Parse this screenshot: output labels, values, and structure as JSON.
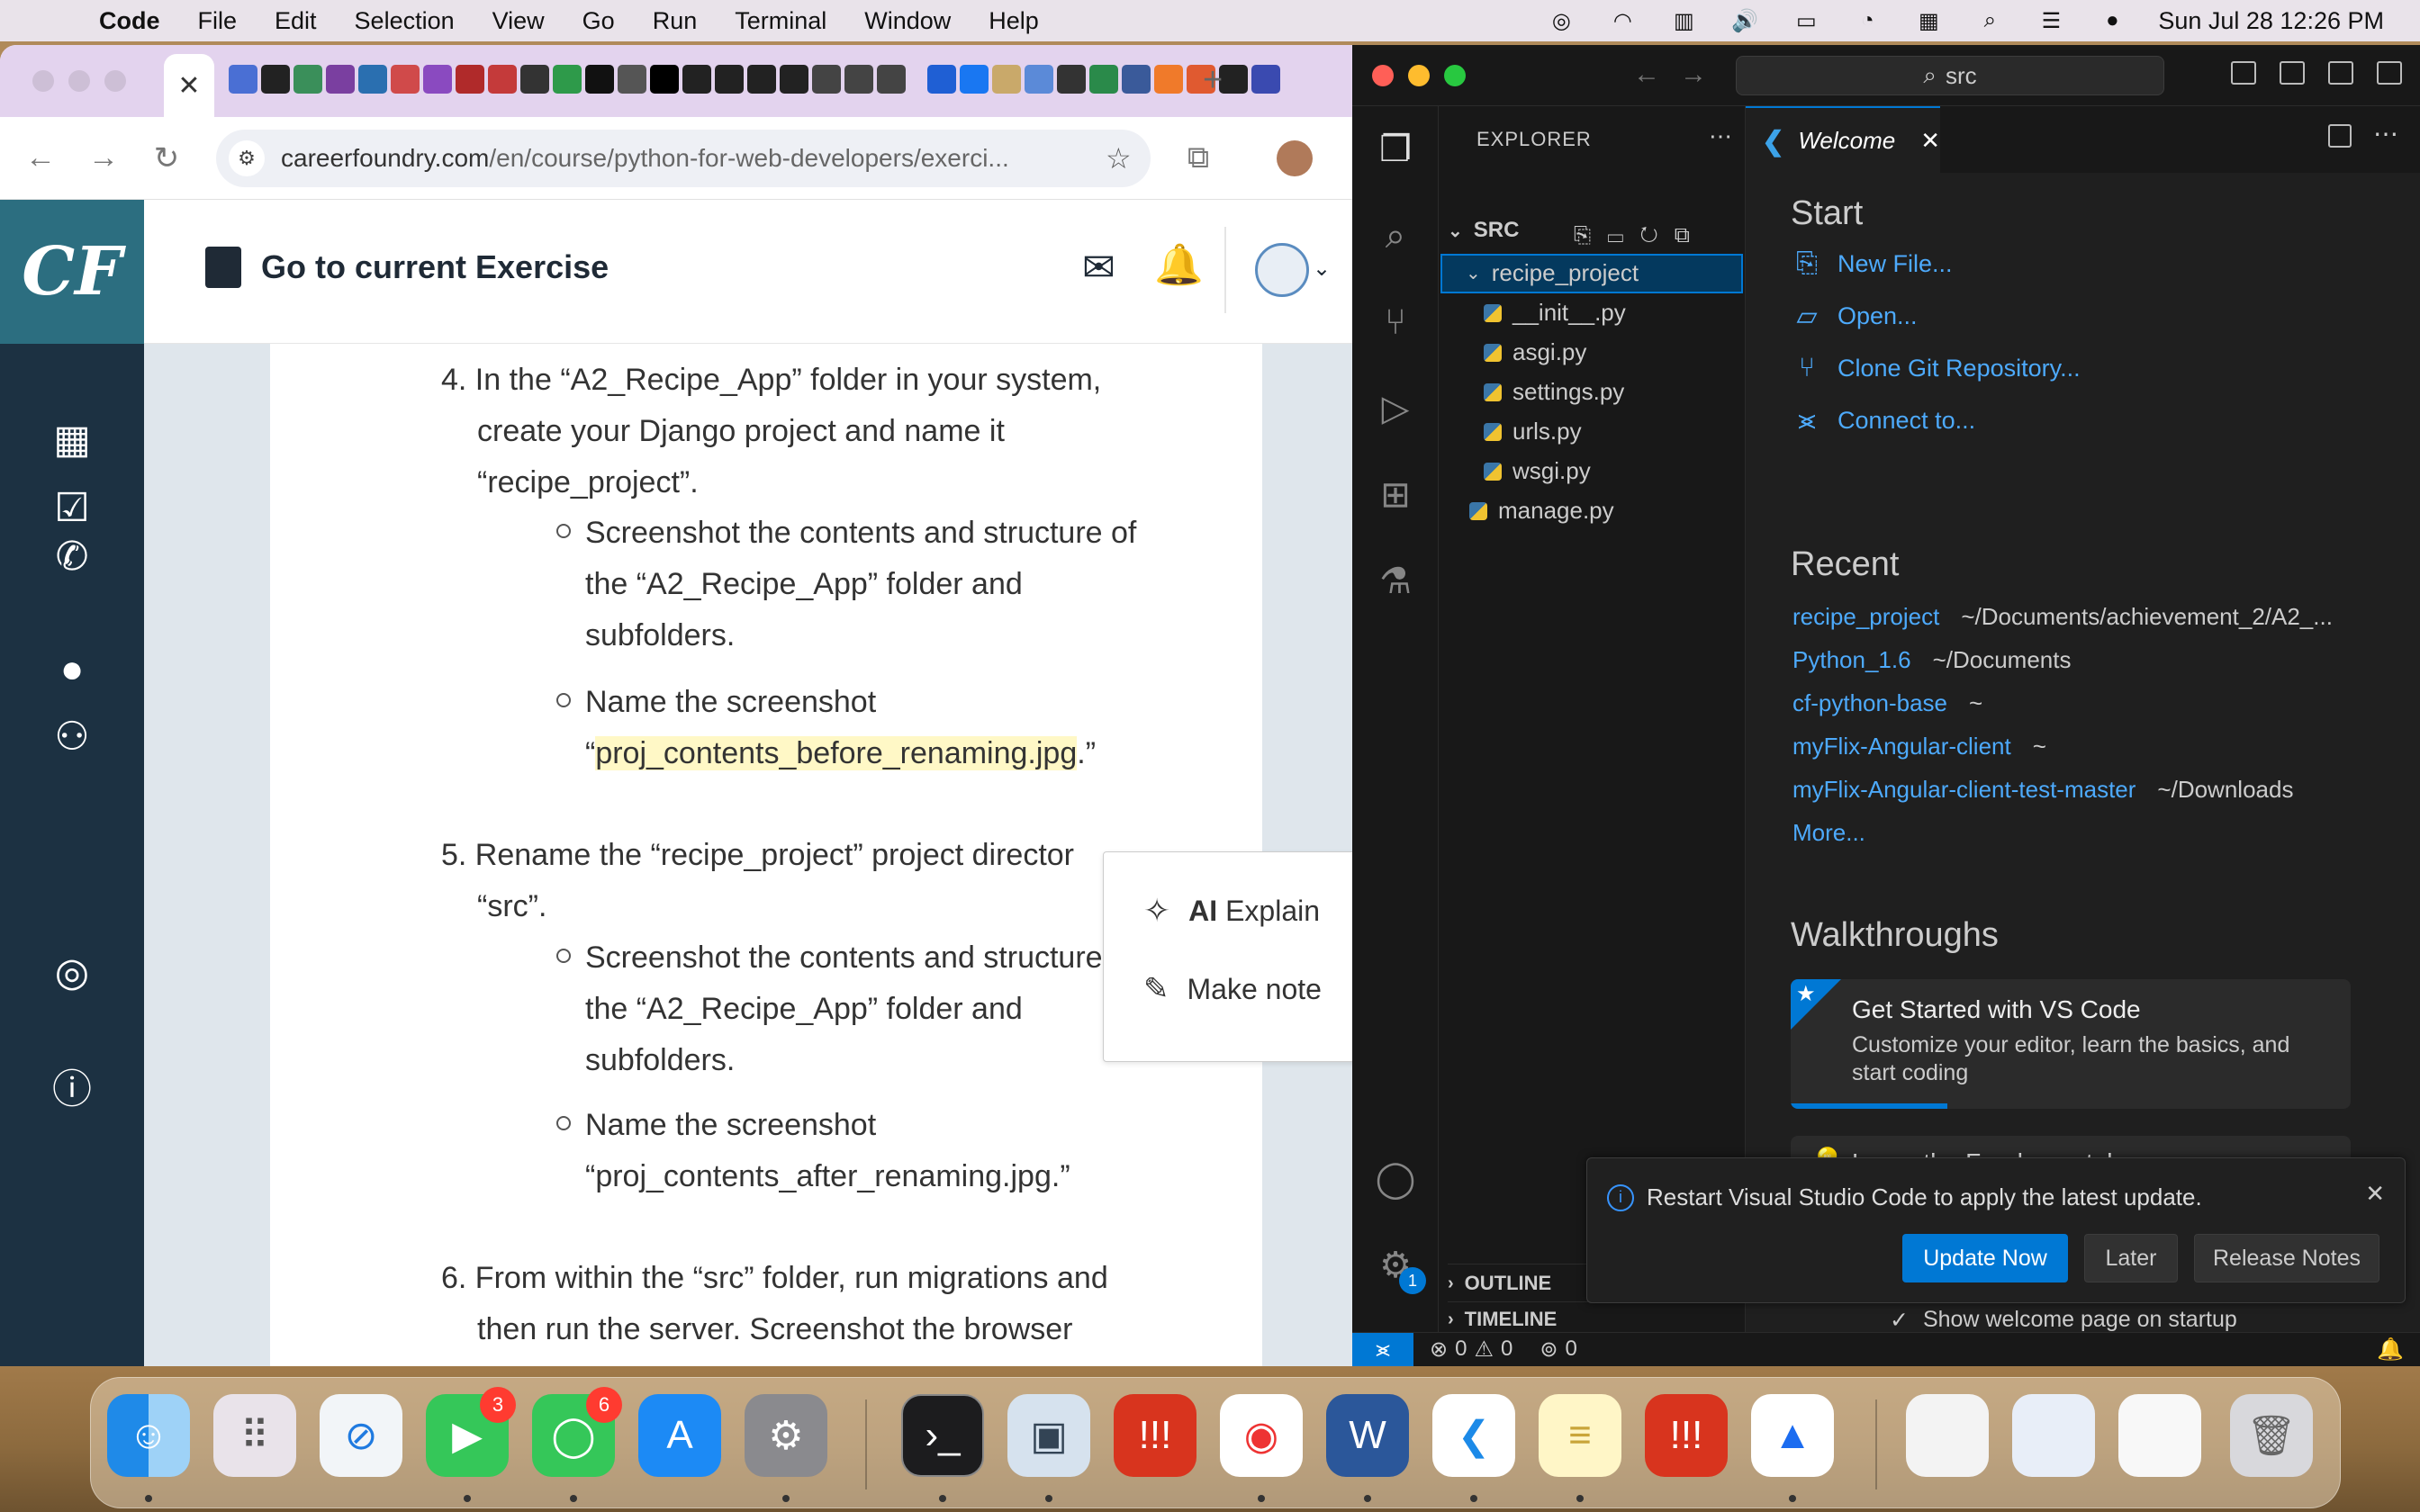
{
  "menubar": {
    "app_name": "Code",
    "menus": [
      "File",
      "Edit",
      "Selection",
      "View",
      "Go",
      "Run",
      "Terminal",
      "Window",
      "Help"
    ],
    "datetime": "Sun Jul 28  12:26 PM"
  },
  "chrome": {
    "url_host": "careerfoundry.com",
    "url_path": "/en/course/python-for-web-developers/exerci...",
    "tab_close": "✕",
    "new_tab": "+"
  },
  "cf": {
    "logo": "CF",
    "header_title": "Go to current Exercise",
    "steps": {
      "s4_line1": "4. In the “A2_Recipe_App” folder in your system,",
      "s4_line2": "create your Django project and name it",
      "s4_line3": "“recipe_project”.",
      "s4_b1_line1": "Screenshot the contents and structure of",
      "s4_b1_line2": "the “A2_Recipe_App” folder and",
      "s4_b1_line3": "subfolders.",
      "s4_b2_line1": "Name the screenshot",
      "s4_b2_open": "“",
      "s4_b2_hl": "proj_contents_before_renaming.jpg",
      "s4_b2_close": ".”",
      "s5_line1": "5. Rename the “recipe_project” project director",
      "s5_line2": "“src”.",
      "s5_b1_line1": "Screenshot the contents and structure",
      "s5_b1_line2": "the “A2_Recipe_App” folder and",
      "s5_b1_line3": "subfolders.",
      "s5_b2_line1": "Name the screenshot",
      "s5_b2_line2": "“proj_contents_after_renaming.jpg.”",
      "s6_line1": "6. From within the “src” folder, run migrations and",
      "s6_line2": "then run the server. Screenshot the browser"
    },
    "popup": {
      "ai_label": "AI",
      "explain": "Explain",
      "make_note": "Make note"
    }
  },
  "vscode": {
    "search": "src",
    "explorer_title": "EXPLORER",
    "root": "SRC",
    "folder": "recipe_project",
    "files": [
      "__init__.py",
      "asgi.py",
      "settings.py",
      "urls.py",
      "wsgi.py"
    ],
    "root_file": "manage.py",
    "outline": "OUTLINE",
    "timeline": "TIMELINE",
    "tab_title": "Welcome",
    "start_title": "Start",
    "start_links": [
      "New File...",
      "Open...",
      "Clone Git Repository...",
      "Connect to..."
    ],
    "recent_title": "Recent",
    "recent": [
      {
        "name": "recipe_project",
        "path": "~/Documents/achievement_2/A2_..."
      },
      {
        "name": "Python_1.6",
        "path": "~/Documents"
      },
      {
        "name": "cf-python-base",
        "path": "~"
      },
      {
        "name": "myFlix-Angular-client",
        "path": "~"
      },
      {
        "name": "myFlix-Angular-client-test-master",
        "path": "~/Downloads"
      }
    ],
    "more": "More...",
    "walkthroughs_title": "Walkthroughs",
    "walk1_title": "Get Started with VS Code",
    "walk1_desc": "Customize your editor, learn the basics, and start coding",
    "walk1_progress": 0.28,
    "walk2_title": "Learn the Fundamentals",
    "show_welcome": "Show welcome page on startup",
    "notification": {
      "message": "Restart Visual Studio Code to apply the latest update.",
      "update_now": "Update Now",
      "later": "Later",
      "release_notes": "Release Notes"
    },
    "status": {
      "errors": "0",
      "warnings": "0",
      "ports": "0"
    },
    "settings_badge": "1"
  },
  "dock": {
    "facetime_badge": "3",
    "messages_badge": "6"
  },
  "colors": {
    "vs_accent": "#0078d4",
    "vs_link": "#4daafc",
    "cf_sidebar": "#1c3142",
    "cf_logo_bg": "#2c6e80"
  }
}
